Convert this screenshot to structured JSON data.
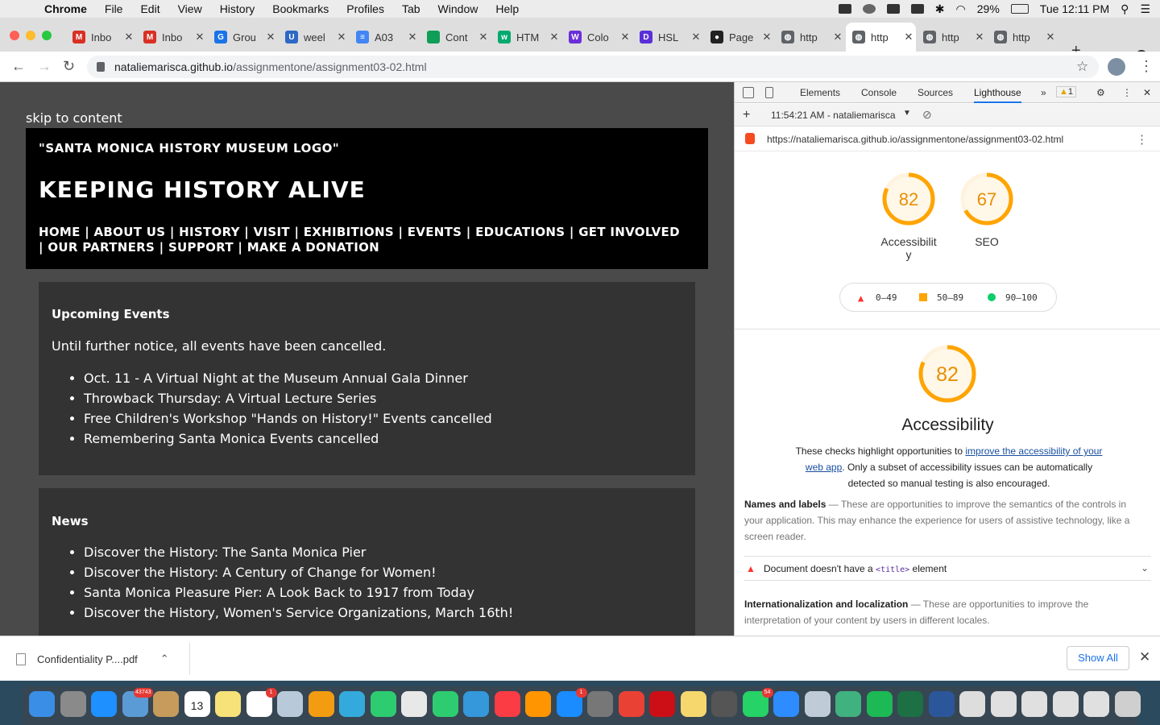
{
  "menubar": {
    "apple": "",
    "app": "Chrome",
    "items": [
      "File",
      "Edit",
      "View",
      "History",
      "Bookmarks",
      "Profiles",
      "Tab",
      "Window",
      "Help"
    ],
    "battery": "29%",
    "clock": "Tue 12:11 PM"
  },
  "tabs": [
    {
      "title": "Inbo",
      "icon": "gmail-icon",
      "color": "#d93025",
      "glyph": "M"
    },
    {
      "title": "Inbo",
      "icon": "gmail-icon",
      "color": "#d93025",
      "glyph": "M"
    },
    {
      "title": "Grou",
      "icon": "groups-icon",
      "color": "#1a73e8",
      "glyph": "G"
    },
    {
      "title": "weel",
      "icon": "ucla-icon",
      "color": "#2d68c4",
      "glyph": "U"
    },
    {
      "title": "A03",
      "icon": "docs-icon",
      "color": "#4285f4",
      "glyph": "≡"
    },
    {
      "title": "Cont",
      "icon": "sheets-icon",
      "color": "#0f9d58",
      "glyph": ""
    },
    {
      "title": "HTM",
      "icon": "w3schools-icon",
      "color": "#04aa6d",
      "glyph": "w"
    },
    {
      "title": "Colo",
      "icon": "w-icon",
      "color": "#6b2fd9",
      "glyph": "W"
    },
    {
      "title": "HSL",
      "icon": "d-icon",
      "color": "#5b2fd9",
      "glyph": "D"
    },
    {
      "title": "Page",
      "icon": "github-icon",
      "color": "#222222",
      "glyph": "●"
    },
    {
      "title": "http",
      "icon": "globe-icon",
      "color": "#5f6368",
      "glyph": "◍"
    },
    {
      "title": "http",
      "icon": "globe-icon",
      "color": "#5f6368",
      "glyph": "◍"
    },
    {
      "title": "http",
      "icon": "globe-icon",
      "color": "#5f6368",
      "glyph": "◍"
    },
    {
      "title": "http",
      "icon": "globe-icon",
      "color": "#5f6368",
      "glyph": "◍"
    }
  ],
  "address": {
    "host": "nataliemarisca.github.io",
    "path": "/assignmentone/assignment03-02.html"
  },
  "page": {
    "skip": "skip to content",
    "logo": "\"SANTA MONICA HISTORY MUSEUM LOGO\"",
    "heading": "KEEPING HISTORY ALIVE",
    "nav": [
      "HOME",
      "ABOUT US",
      "HISTORY",
      "VISIT",
      "EXHIBITIONS",
      "EVENTS",
      "EDUCATIONS",
      "GET INVOLVED",
      "OUR PARTNERS",
      "SUPPORT",
      "MAKE A DONATION"
    ],
    "events": {
      "title": "Upcoming Events",
      "notice": "Until further notice, all events have been cancelled.",
      "items": [
        "Oct. 11 - A Virtual Night at the Museum Annual Gala Dinner",
        "Throwback Thursday: A Virtual Lecture Series",
        "Free Children's Workshop \"Hands on History!\" Events cancelled",
        "Remembering Santa Monica Events cancelled"
      ]
    },
    "news": {
      "title": "News",
      "items": [
        "Discover the History: The Santa Monica Pier",
        "Discover the History: A Century of Change for Women!",
        "Santa Monica Pleasure Pier: A Look Back to 1917 from Today",
        "Discover the History, Women's Service Organizations, March 16th!"
      ]
    }
  },
  "devtools": {
    "tabs": [
      "Elements",
      "Console",
      "Sources",
      "Lighthouse"
    ],
    "more": "»",
    "warning_count": "1",
    "report_time": "11:54:21 AM - nataliemarisca",
    "url": "https://nataliemarisca.github.io/assignmentone/assignment03-02.html",
    "scores": [
      {
        "label_line1": "Accessibilit",
        "label_line2": "y",
        "value": 82
      },
      {
        "label_line1": "SEO",
        "label_line2": "",
        "value": 67
      }
    ],
    "legend": [
      "0–49",
      "50–89",
      "90–100"
    ],
    "legend_colors": [
      "#ff3333",
      "#ffa400",
      "#0cce6b"
    ],
    "gauge_color": "#ffa400",
    "main_score": 82,
    "section_title": "Accessibility",
    "desc_before": "These checks highlight opportunities to ",
    "desc_link": "improve the accessibility of your web app",
    "desc_after": ". Only a subset of accessibility issues can be automatically detected so manual testing is also encouraged.",
    "group1_title": "Names and labels",
    "group1_text": " — These are opportunities to improve the semantics of the controls in your application. This may enhance the experience for users of assistive technology, like a screen reader.",
    "audit_before": "Document doesn't have a ",
    "audit_code": "<title>",
    "audit_after": " element",
    "group2_title": "Internationalization and localization",
    "group2_text": " — These are opportunities to improve the interpretation of your content by users in different locales."
  },
  "download": {
    "file": "Confidentiality P....pdf",
    "show_all": "Show All"
  },
  "dock": {
    "badges": {
      "mail": "43743",
      "calendar_day": "13",
      "calendar_month": "JUL",
      "reminders": "1",
      "appstore": "1",
      "whatsapp": "54"
    }
  }
}
